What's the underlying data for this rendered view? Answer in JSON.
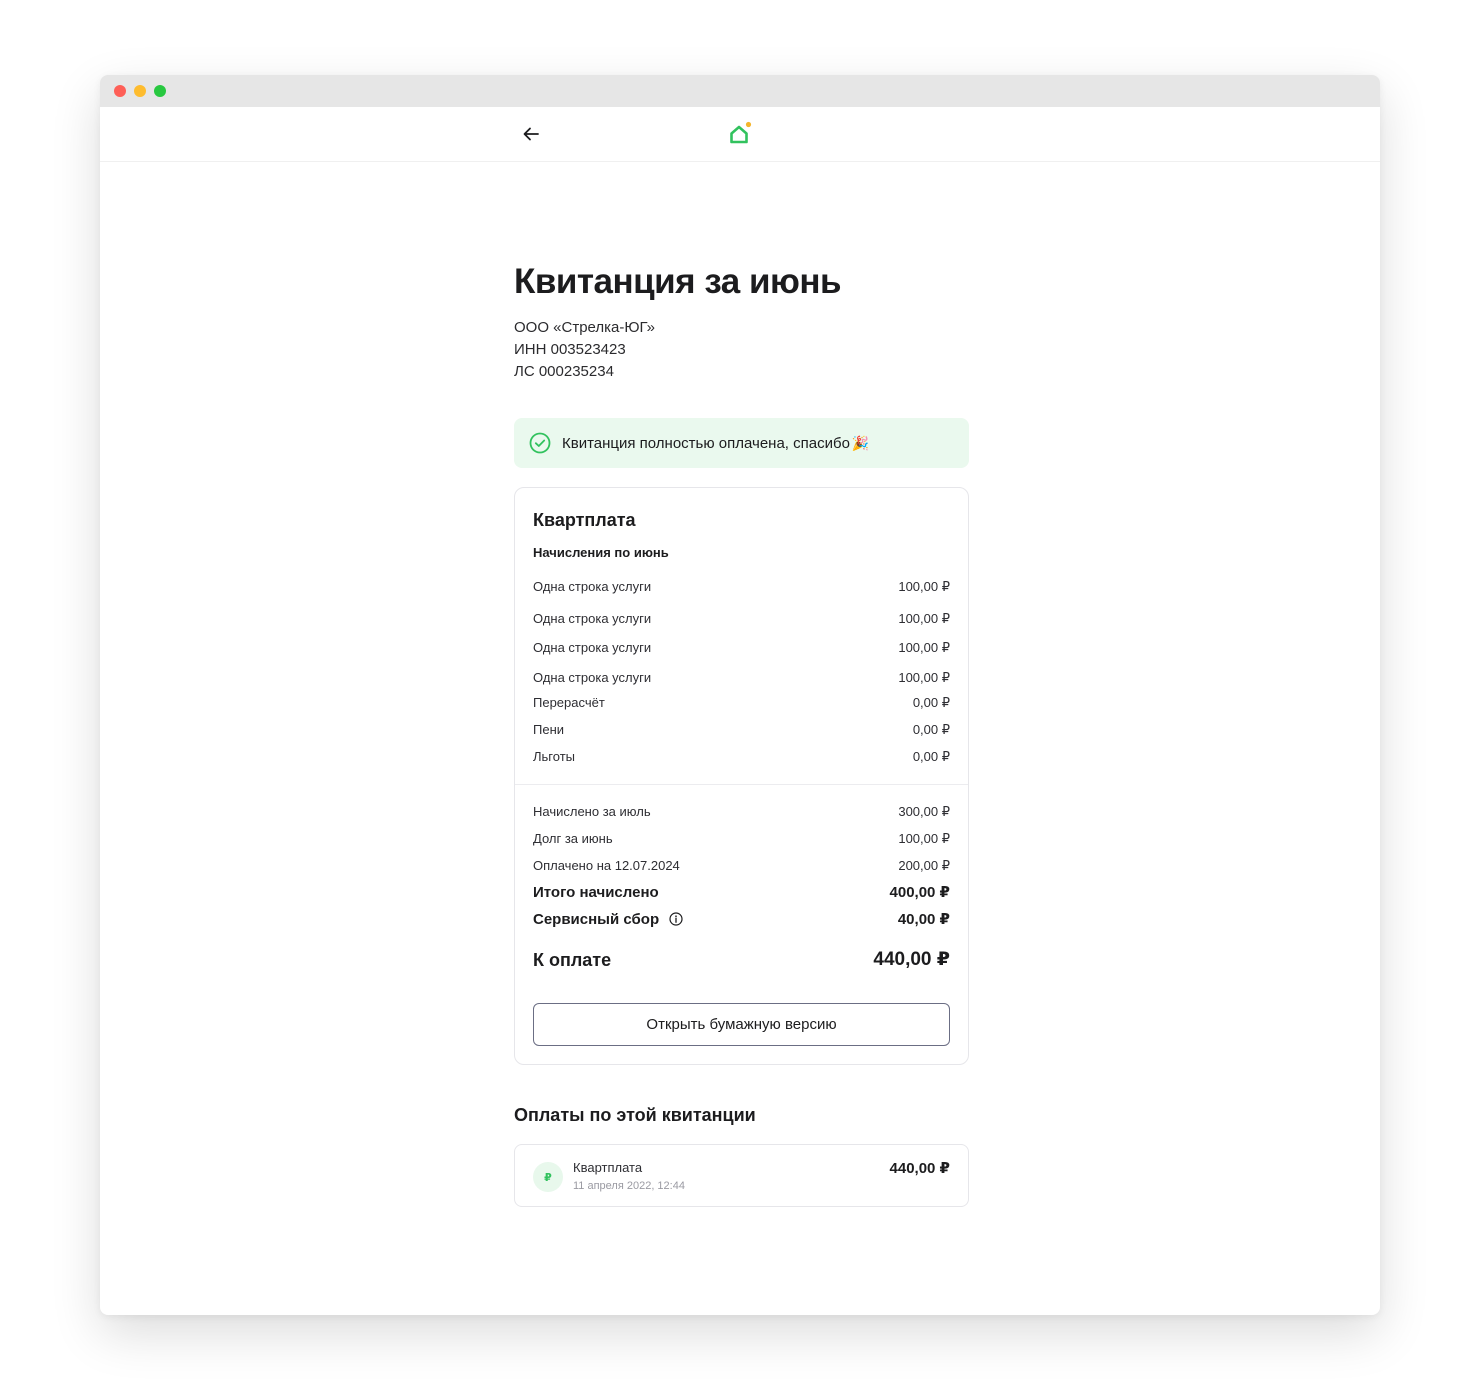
{
  "header": {
    "back_icon": "arrow-left-icon",
    "logo_icon": "house-logo-icon",
    "logo_color": "#32c25e",
    "logo_dot_color": "#f5b52c"
  },
  "receipt": {
    "title": "Квитанция за июнь",
    "org_name": "ООО «Стрелка-ЮГ»",
    "inn": "ИНН 003523423",
    "account": "ЛС 000235234"
  },
  "status": {
    "text": "Квитанция полностью оплачена, спасибо",
    "emoji": "🎉",
    "bg_color": "#eaf9ee",
    "icon": "check-circle-icon"
  },
  "card": {
    "title": "Квартплата",
    "subtitle": "Начисления по июнь",
    "charges": [
      {
        "label": "Одна строка услуги",
        "amount": "100,00 ₽"
      },
      {
        "label": "Одна строка услуги",
        "amount": "100,00 ₽"
      },
      {
        "label": "Одна строка услуги",
        "amount": "100,00 ₽"
      },
      {
        "label": "Одна строка услуги",
        "amount": "100,00 ₽"
      },
      {
        "label": "Перерасчёт",
        "amount": "0,00 ₽"
      },
      {
        "label": "Пени",
        "amount": "0,00 ₽"
      },
      {
        "label": "Льготы",
        "amount": "0,00 ₽"
      }
    ],
    "summary": [
      {
        "label": "Начислено за июль",
        "amount": "300,00 ₽"
      },
      {
        "label": "Долг за июнь",
        "amount": "100,00 ₽"
      },
      {
        "label": "Оплачено на 12.07.2024",
        "amount": "200,00 ₽"
      }
    ],
    "total_label": "Итого начислено",
    "total_amount": "400,00 ₽",
    "fee_label": "Сервисный сбор",
    "fee_amount": "40,00 ₽",
    "pay_label": "К оплате",
    "pay_amount": "440,00 ₽",
    "paper_button": "Открыть бумажную версию"
  },
  "payments": {
    "title": "Оплаты по этой квитанции",
    "items": [
      {
        "icon_text": "₽",
        "name": "Квартплата",
        "date": "11 апреля 2022, 12:44",
        "amount": "440,00 ₽"
      }
    ]
  }
}
